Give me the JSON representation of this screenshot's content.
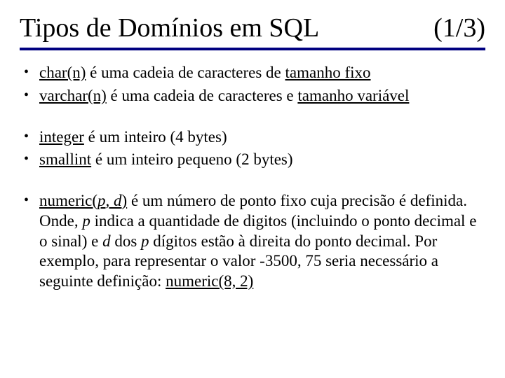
{
  "header": {
    "title": "Tipos de Domínios em SQL",
    "pager": "(1/3)"
  },
  "bullets": {
    "b1": {
      "u1": "char(n)",
      "t1": " é uma cadeia de caracteres de ",
      "u2": "tamanho fixo"
    },
    "b2": {
      "u1": "varchar(n)",
      "t1": " é uma cadeia de caracteres e ",
      "u2": "tamanho variável"
    },
    "b3": {
      "u1": "integer",
      "t1": " é um inteiro (4 bytes)"
    },
    "b4": {
      "u1": "smallint",
      "t1": " é um inteiro pequeno (2 bytes)"
    },
    "b5": {
      "u1": "numeric(",
      "i1": "p",
      "t1": ", ",
      "i2": "d",
      "t2": ")",
      "t3": " é um número de ponto fixo cuja precisão é definida. Onde, ",
      "i3": "p",
      "t4": " indica a quantidade de digitos (incluindo o ponto decimal e o sinal) e ",
      "i4": "d",
      "t5": " dos ",
      "i5": "p",
      "t6": " dígitos estão à direita do ponto decimal. Por exemplo, para representar o valor -3500, 75 seria necessário a seguinte definição: ",
      "u2": "numeric(8, 2)"
    }
  }
}
